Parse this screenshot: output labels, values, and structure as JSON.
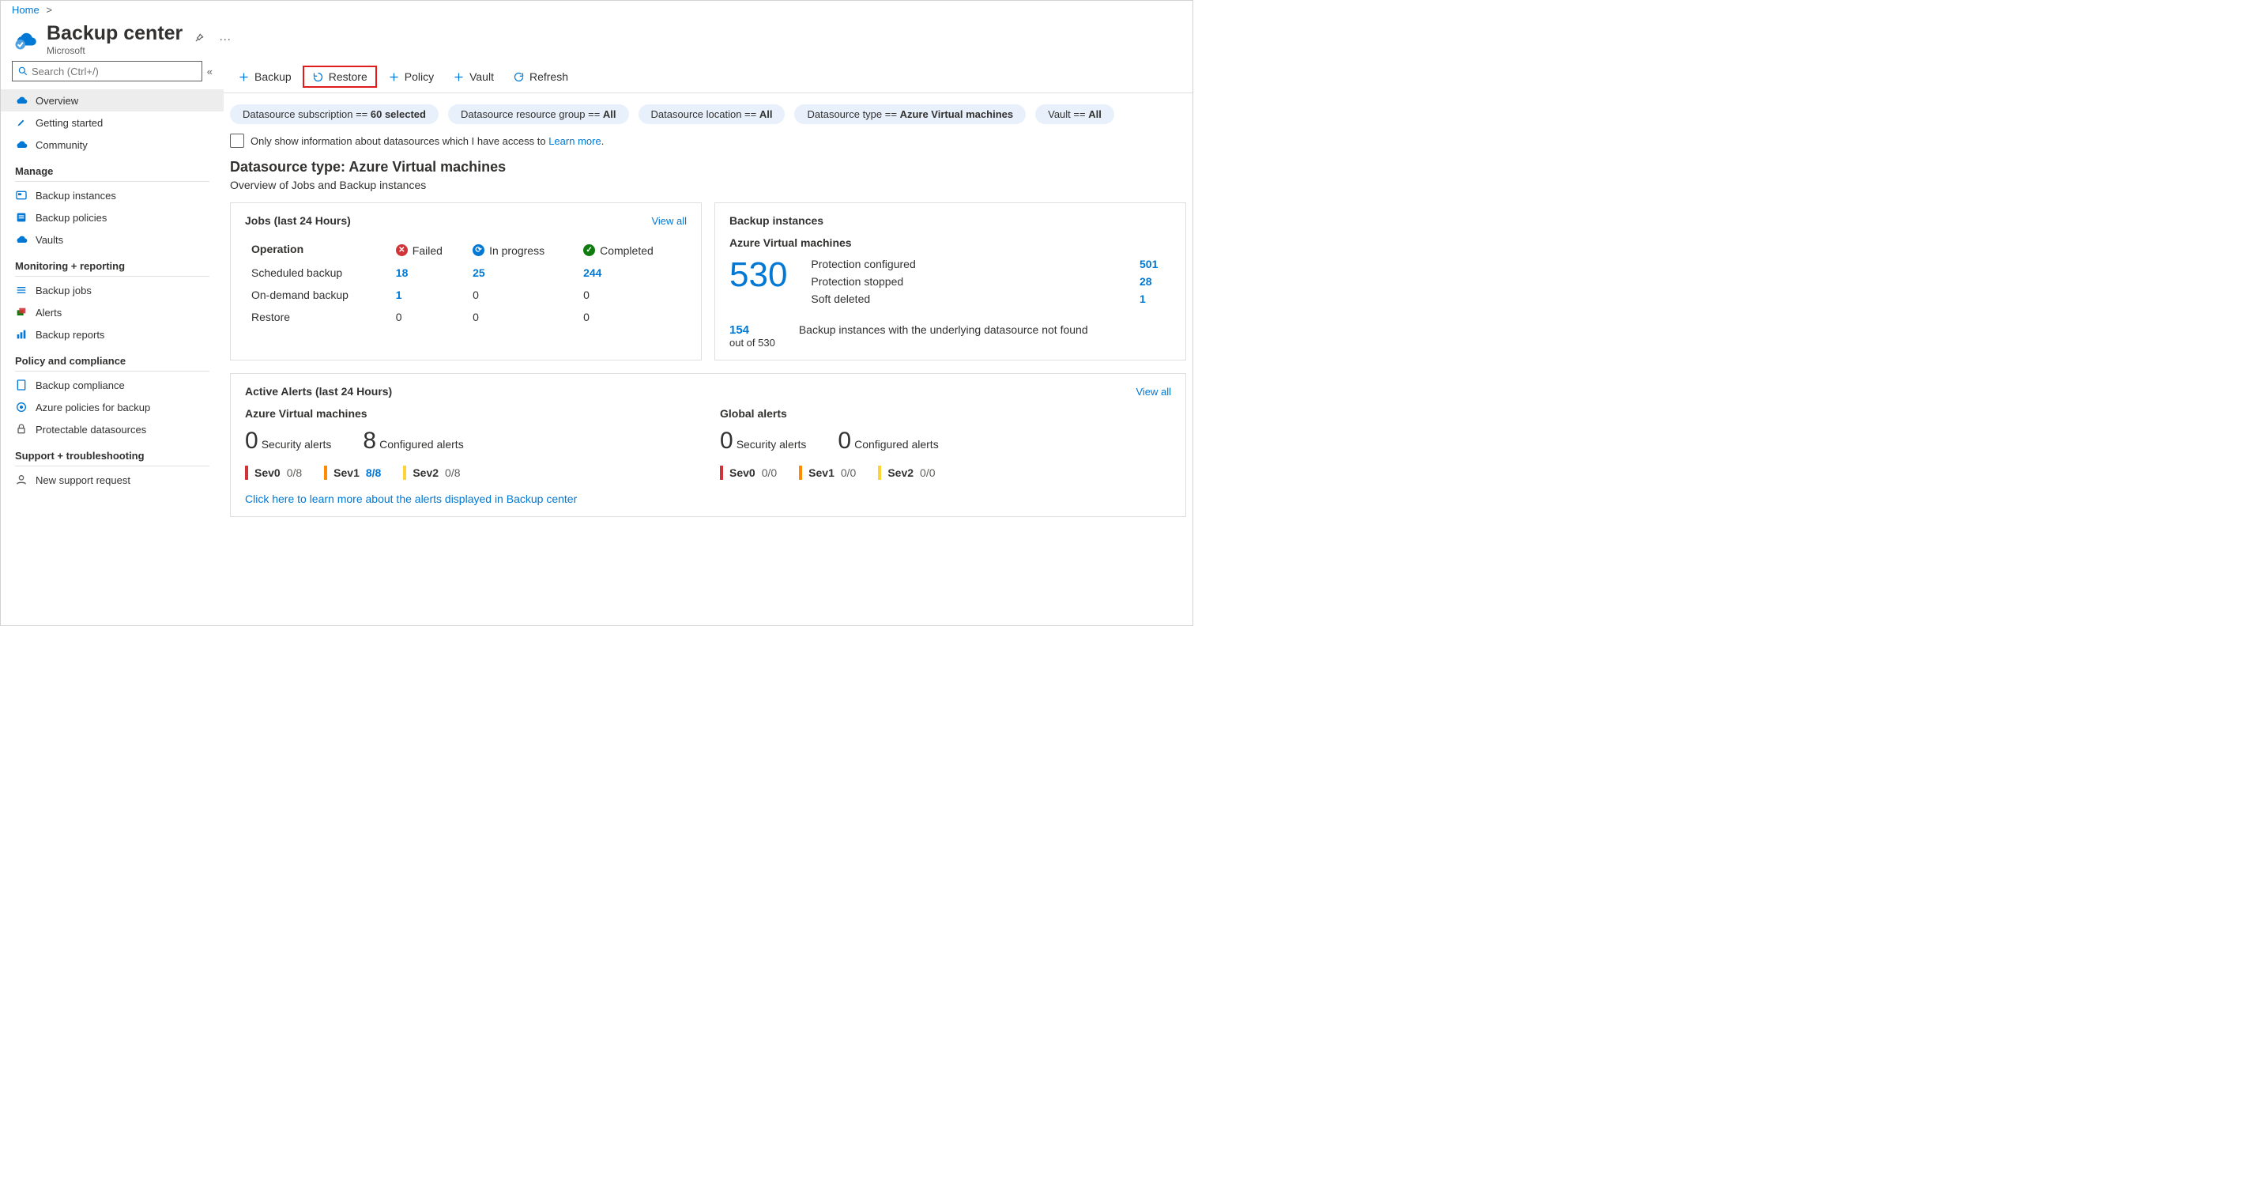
{
  "breadcrumb": {
    "home": "Home"
  },
  "header": {
    "title": "Backup center",
    "subtitle": "Microsoft"
  },
  "search": {
    "placeholder": "Search (Ctrl+/)"
  },
  "sidebar": {
    "top": [
      {
        "label": "Overview"
      },
      {
        "label": "Getting started"
      },
      {
        "label": "Community"
      }
    ],
    "sections": [
      {
        "title": "Manage",
        "items": [
          {
            "label": "Backup instances"
          },
          {
            "label": "Backup policies"
          },
          {
            "label": "Vaults"
          }
        ]
      },
      {
        "title": "Monitoring + reporting",
        "items": [
          {
            "label": "Backup jobs"
          },
          {
            "label": "Alerts"
          },
          {
            "label": "Backup reports"
          }
        ]
      },
      {
        "title": "Policy and compliance",
        "items": [
          {
            "label": "Backup compliance"
          },
          {
            "label": "Azure policies for backup"
          },
          {
            "label": "Protectable datasources"
          }
        ]
      },
      {
        "title": "Support + troubleshooting",
        "items": [
          {
            "label": "New support request"
          }
        ]
      }
    ]
  },
  "toolbar": {
    "backup": "Backup",
    "restore": "Restore",
    "policy": "Policy",
    "vault": "Vault",
    "refresh": "Refresh"
  },
  "filters": {
    "sub_label": "Datasource subscription == ",
    "sub_val": "60 selected",
    "rg_label": "Datasource resource group == ",
    "rg_val": "All",
    "loc_label": "Datasource location == ",
    "loc_val": "All",
    "type_label": "Datasource type == ",
    "type_val": "Azure Virtual machines",
    "vault_label": "Vault == ",
    "vault_val": "All"
  },
  "checkbox": {
    "label": "Only show information about datasources which I have access to ",
    "learn": "Learn more"
  },
  "section": {
    "title": "Datasource type: Azure Virtual machines",
    "desc": "Overview of Jobs and Backup instances"
  },
  "jobs": {
    "title": "Jobs (last 24 Hours)",
    "viewall": "View all",
    "op_head": "Operation",
    "failed": "Failed",
    "inprog": "In progress",
    "completed": "Completed",
    "rows": [
      {
        "op": "Scheduled backup",
        "f": "18",
        "p": "25",
        "c": "244",
        "fl": true,
        "pl": true,
        "cl": true
      },
      {
        "op": "On-demand backup",
        "f": "1",
        "p": "0",
        "c": "0",
        "fl": true
      },
      {
        "op": "Restore",
        "f": "0",
        "p": "0",
        "c": "0"
      }
    ]
  },
  "bi": {
    "title": "Backup instances",
    "sub": "Azure Virtual machines",
    "total": "530",
    "rows": [
      {
        "label": "Protection configured",
        "val": "501"
      },
      {
        "label": "Protection stopped",
        "val": "28"
      },
      {
        "label": "Soft deleted",
        "val": "1"
      }
    ],
    "notfound_n": "154",
    "notfound_of": "out of 530",
    "notfound_txt": "Backup instances with the underlying datasource not found"
  },
  "alerts": {
    "title": "Active Alerts (last 24 Hours)",
    "viewall": "View all",
    "avm": {
      "title": "Azure Virtual machines",
      "sec_n": "0",
      "sec_l": "Security alerts",
      "conf_n": "8",
      "conf_l": "Configured alerts",
      "sev": [
        {
          "name": "Sev0",
          "frac": "0/8"
        },
        {
          "name": "Sev1",
          "frac": "8/8",
          "link": true
        },
        {
          "name": "Sev2",
          "frac": "0/8"
        }
      ]
    },
    "global": {
      "title": "Global alerts",
      "sec_n": "0",
      "sec_l": "Security alerts",
      "conf_n": "0",
      "conf_l": "Configured alerts",
      "sev": [
        {
          "name": "Sev0",
          "frac": "0/0"
        },
        {
          "name": "Sev1",
          "frac": "0/0"
        },
        {
          "name": "Sev2",
          "frac": "0/0"
        }
      ]
    },
    "learn": "Click here to learn more about the alerts displayed in Backup center"
  }
}
